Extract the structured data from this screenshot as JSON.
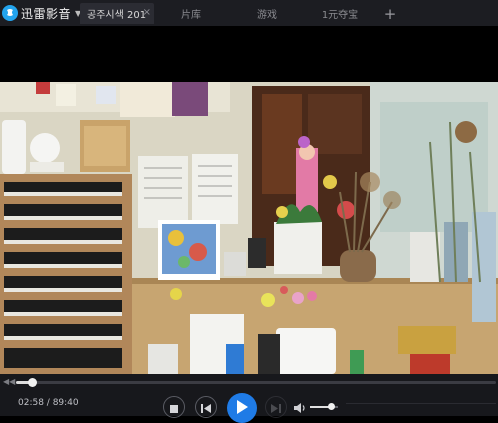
{
  "app": {
    "logo_text": "迅雷影音",
    "logo_icon": "xunlei-logo-icon",
    "colors": {
      "brand": "#23a4ee",
      "play": "#1f7be6"
    }
  },
  "tabs": [
    {
      "label": "공주시색 201",
      "active": true
    },
    {
      "label": "片库",
      "active": false
    },
    {
      "label": "游戏",
      "active": false
    },
    {
      "label": "1元夺宝",
      "active": false
    }
  ],
  "tab_close_symbol": "×",
  "tab_add_symbol": "+",
  "playback": {
    "current_time": "02:58",
    "total_time": "89:40",
    "time_text": "02:58 / 89:40",
    "progress_fraction": 0.033,
    "volume_fraction": 0.75
  },
  "icons": {
    "stop": "stop-icon",
    "prev": "previous-icon",
    "play": "play-icon",
    "next": "next-icon",
    "volume": "volume-icon"
  }
}
